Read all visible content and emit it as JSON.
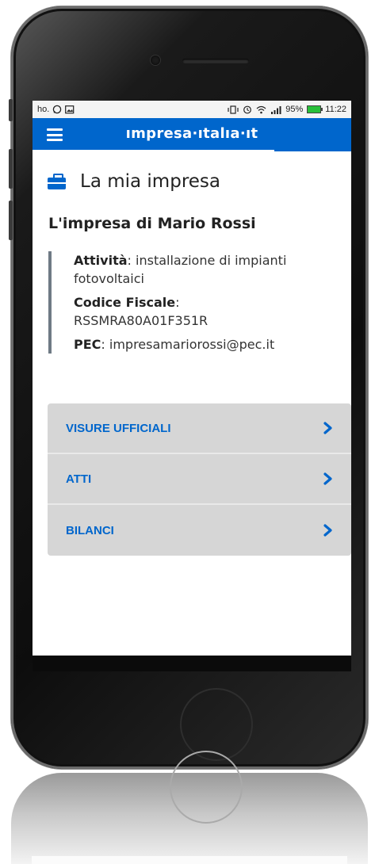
{
  "status_bar": {
    "left": "ho.",
    "battery": "95%",
    "time": "11:22"
  },
  "header": {
    "brand": "ımpresa·ıtalıa·ıt",
    "menu_icon": "hamburger-icon"
  },
  "page": {
    "title": "La mia impresa",
    "title_icon": "briefcase-icon"
  },
  "company": {
    "name": "L'impresa di Mario Rossi",
    "fields": [
      {
        "label": "Attività",
        "value": "installazione di impianti fotovoltaici"
      },
      {
        "label": "Codice Fiscale",
        "value": "RSSMRA80A01F351R"
      },
      {
        "label": "PEC",
        "value": "impresamariorossi@pec.it"
      }
    ]
  },
  "menu": {
    "items": [
      {
        "label": "VISURE UFFICIALI",
        "icon": "chevron-right-icon"
      },
      {
        "label": "ATTI",
        "icon": "chevron-right-icon"
      },
      {
        "label": "BILANCI",
        "icon": "chevron-right-icon"
      }
    ]
  },
  "colors": {
    "brand_blue": "#0066cc",
    "menu_background": "#d6d6d6",
    "detail_border": "#6f7a85"
  }
}
